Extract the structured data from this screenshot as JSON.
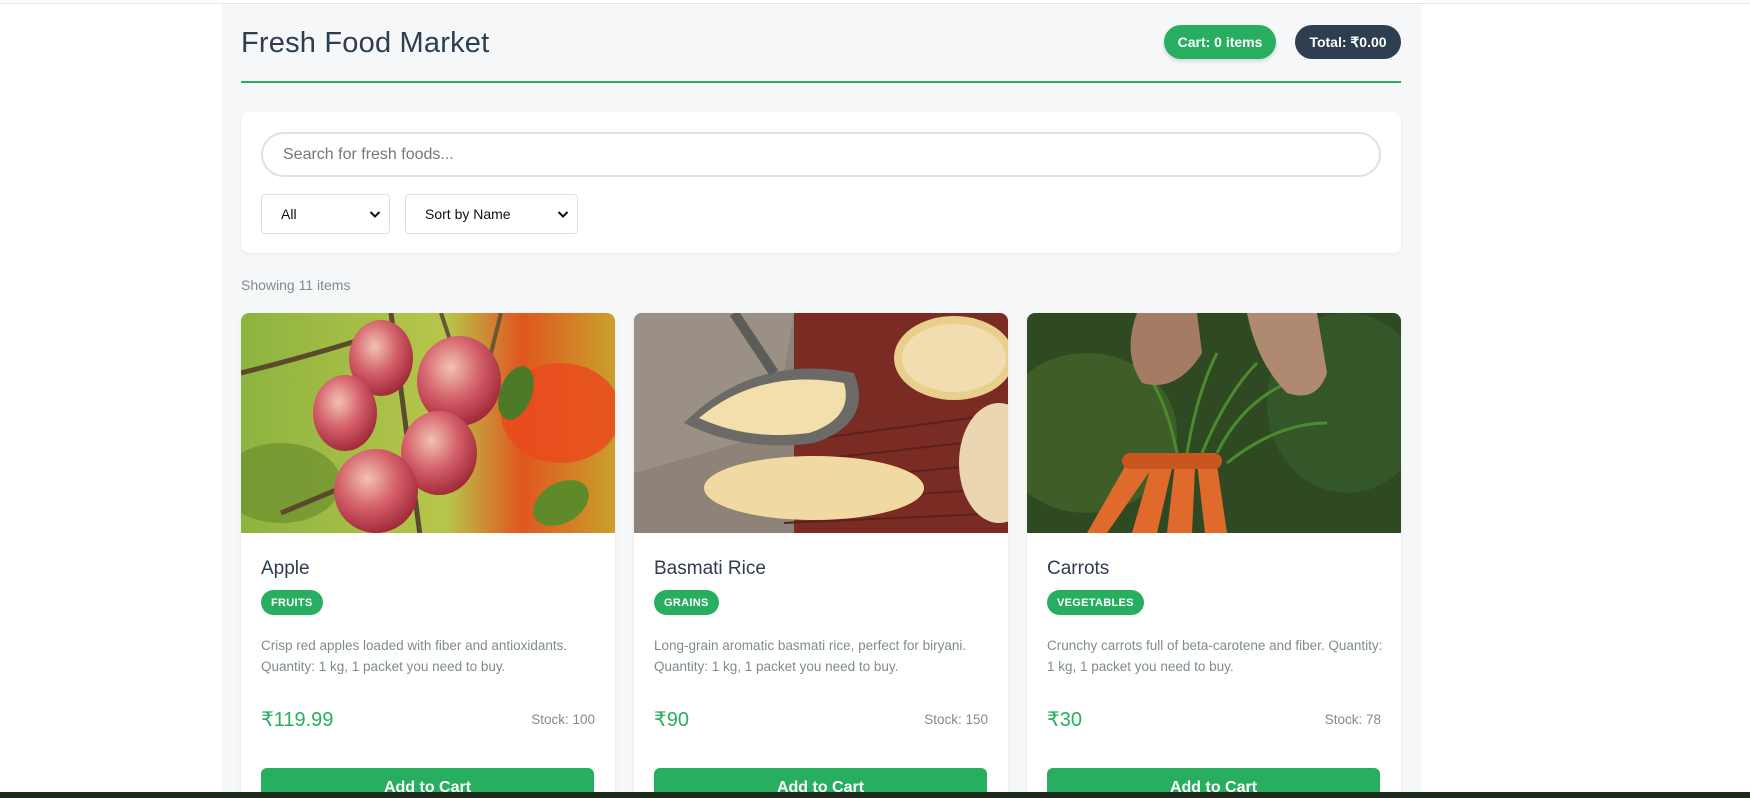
{
  "header": {
    "title": "Fresh Food Market",
    "cart_label": "Cart: 0 items",
    "total_label": "Total: ₹0.00"
  },
  "filters": {
    "search_placeholder": "Search for fresh foods...",
    "category_selected": "All",
    "sort_selected": "Sort by Name"
  },
  "results": {
    "count_label": "Showing 11 items"
  },
  "products": [
    {
      "name": "Apple",
      "category": "FRUITS",
      "description": "Crisp red apples loaded with fiber and antioxidants. Quantity: 1 kg, 1 packet you need to buy.",
      "price": "₹119.99",
      "stock": "Stock: 100",
      "button": "Add to Cart",
      "image": "apples-on-branch-photo"
    },
    {
      "name": "Basmati Rice",
      "category": "GRAINS",
      "description": "Long-grain aromatic basmati rice, perfect for biryani. Quantity: 1 kg, 1 packet you need to buy.",
      "price": "₹90",
      "stock": "Stock: 150",
      "button": "Add to Cart",
      "image": "rice-in-scoop-photo"
    },
    {
      "name": "Carrots",
      "category": "VEGETABLES",
      "description": "Crunchy carrots full of beta-carotene and fiber. Quantity: 1 kg, 1 packet you need to buy.",
      "price": "₹30",
      "stock": "Stock: 78",
      "button": "Add to Cart",
      "image": "carrots-in-hands-photo"
    }
  ],
  "colors": {
    "accent": "#27ae60",
    "dark": "#2c3e50",
    "muted": "#7f8c8d",
    "background": "#f5f7f9"
  }
}
